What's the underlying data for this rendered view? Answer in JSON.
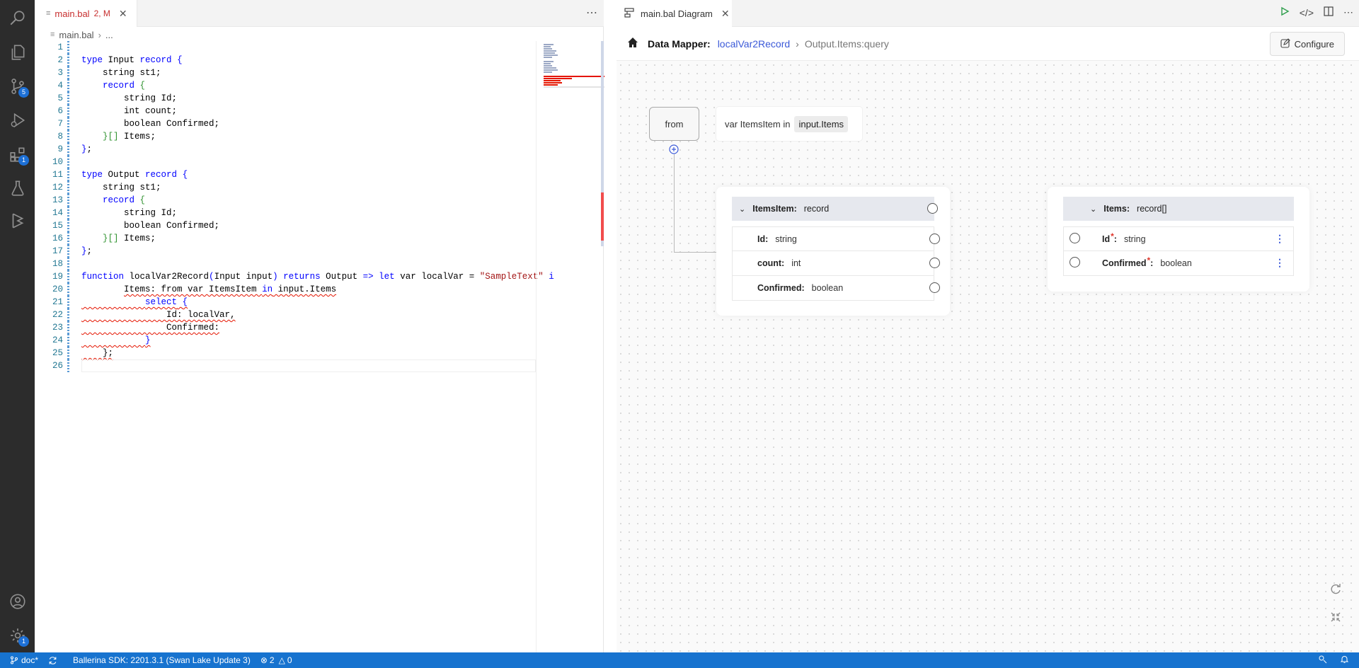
{
  "editor": {
    "tab": {
      "name": "main.bal",
      "status": "2, M"
    },
    "breadcrumb": {
      "file": "main.bal",
      "more": "..."
    },
    "lines": [
      {
        "n": "1",
        "html": ""
      },
      {
        "n": "2",
        "html": "<span class=\"kw\">type</span> Input <span class=\"kw\">record</span> <span class=\"kw\">{</span>"
      },
      {
        "n": "3",
        "html": "    string st1;"
      },
      {
        "n": "4",
        "html": "    <span class=\"kw\">record</span> <span class=\"brk\">{</span>"
      },
      {
        "n": "5",
        "html": "        string Id;"
      },
      {
        "n": "6",
        "html": "        int count;"
      },
      {
        "n": "7",
        "html": "        boolean Confirmed;"
      },
      {
        "n": "8",
        "html": "    <span class=\"brk\">}[]</span> Items;"
      },
      {
        "n": "9",
        "html": "<span class=\"kw\">}</span>;"
      },
      {
        "n": "10",
        "html": ""
      },
      {
        "n": "11",
        "html": "<span class=\"kw\">type</span> Output <span class=\"kw\">record</span> <span class=\"kw\">{</span>"
      },
      {
        "n": "12",
        "html": "    string st1;"
      },
      {
        "n": "13",
        "html": "    <span class=\"kw\">record</span> <span class=\"brk\">{</span>"
      },
      {
        "n": "14",
        "html": "        string Id;"
      },
      {
        "n": "15",
        "html": "        boolean Confirmed;"
      },
      {
        "n": "16",
        "html": "    <span class=\"brk\">}[]</span> Items;"
      },
      {
        "n": "17",
        "html": "<span class=\"kw\">}</span>;"
      },
      {
        "n": "18",
        "html": ""
      },
      {
        "n": "19",
        "html": "<span class=\"kw\">function</span> localVar2Record<span class=\"kw\">(</span>Input input<span class=\"kw\">)</span> <span class=\"kw\">returns</span> Output <span class=\"kw\">=&gt;</span> <span class=\"kw\">let</span> var localVar = <span class=\"str\">\"SampleText\"</span> <span class=\"kw\">i</span>"
      },
      {
        "n": "20",
        "html": "        <span class=\"squig\">Items: from var ItemsItem <span class=\"kw\">in</span> input.Items</span>"
      },
      {
        "n": "21",
        "html": "<span class=\"squig\">            <span class=\"kw\">select</span> <span class=\"kw\">{</span></span>"
      },
      {
        "n": "22",
        "html": "<span class=\"squig\">                Id: localVar,</span>"
      },
      {
        "n": "23",
        "html": "<span class=\"squig\">                Confirmed:</span>"
      },
      {
        "n": "24",
        "html": "<span class=\"squig\">            <span class=\"kw\">}</span></span>"
      },
      {
        "n": "25",
        "html": "<span class=\"squig\">    };</span>"
      },
      {
        "n": "26",
        "html": ""
      }
    ]
  },
  "diagram": {
    "tab": {
      "name": "main.bal Diagram"
    },
    "header": {
      "title": "Data Mapper:",
      "function": "localVar2Record",
      "path": "Output.Items:query",
      "configure_label": "Configure"
    },
    "from": {
      "label": "from",
      "expr_prefix": "var ItemsItem in",
      "expr_source": "input.Items"
    },
    "input_card": {
      "header": {
        "name": "ItemsItem:",
        "type": "record"
      },
      "fields": [
        {
          "name": "Id:",
          "type": "string"
        },
        {
          "name": "count:",
          "type": "int"
        },
        {
          "name": "Confirmed:",
          "type": "boolean"
        }
      ]
    },
    "output_card": {
      "header": {
        "name": "Items:",
        "type": "record[]"
      },
      "fields": [
        {
          "name": "Id",
          "type": "string"
        },
        {
          "name": "Confirmed",
          "type": "boolean"
        }
      ],
      "required_marker": "*",
      "colon": ":"
    }
  },
  "activity": {
    "badges": {
      "source_control": "5",
      "extensions": "1",
      "settings": "1"
    }
  },
  "status": {
    "branch": "doc*",
    "sdk": "Ballerina SDK: 2201.3.1 (Swan Lake Update 3)",
    "errors": "2",
    "warnings": "0"
  }
}
